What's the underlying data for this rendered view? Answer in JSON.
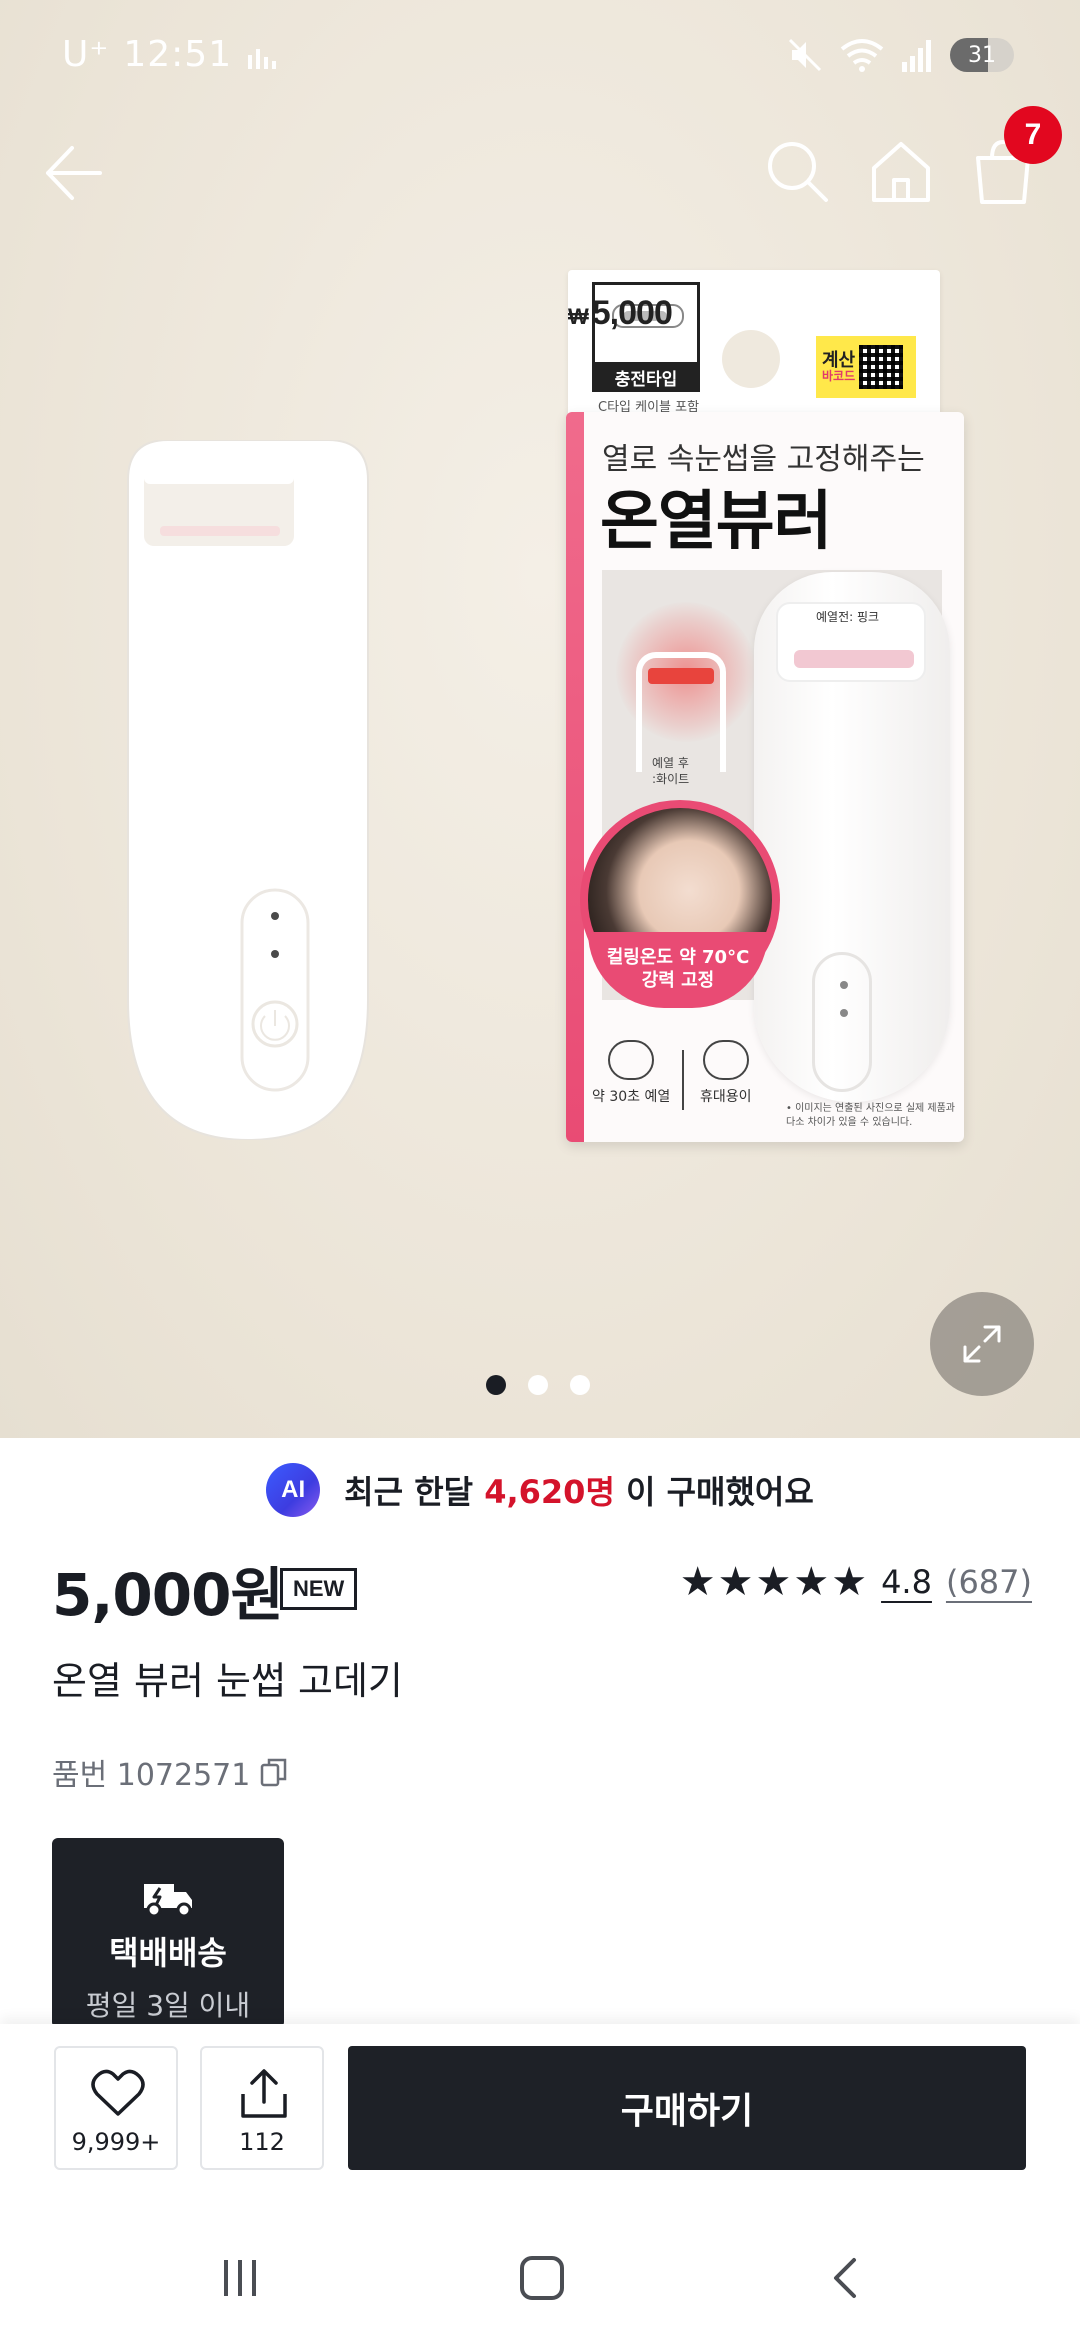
{
  "status_bar": {
    "carrier": "U⁺",
    "time": "12:51",
    "battery": "31"
  },
  "nav": {
    "cart_count": "7"
  },
  "product_box": {
    "charge_type": "충전타입",
    "charge_sub": "C타입 케이블 포함",
    "price": "5,000",
    "currency": "₩",
    "calc_label": "계산",
    "calc_sub": "바코드",
    "subtitle": "열로 속눈썹을 고정해주는",
    "name": "온열뷰러",
    "label_before": "예열전: 핑크",
    "label_after_1": "예열 후",
    "label_after_2": ":화이트",
    "ribbon_1": "컬링온도 약 70°C",
    "ribbon_2": "강력 고정",
    "feature_1": "약 30초 예열",
    "feature_2": "휴대용이",
    "note": "• 이미지는 연출된 사진으로 실제 제품과 다소 차이가 있을 수 있습니다."
  },
  "ai_banner": {
    "badge": "AI",
    "text_before": "최근 한달",
    "highlight": "4,620명",
    "text_after": "이 구매했어요"
  },
  "product": {
    "price": "5,000원",
    "badge": "NEW",
    "rating_score": "4.8",
    "rating_count": "(687)",
    "rating_value": 4.8,
    "name": "온열 뷰러 눈썹 고데기",
    "sku": "품번 1072571"
  },
  "delivery": {
    "title": "택배배송",
    "sub": "평일 3일 이내"
  },
  "bottom_bar": {
    "like_count": "9,999+",
    "share_count": "112",
    "buy_label": "구매하기"
  },
  "gallery": {
    "total": 3,
    "active": 1
  }
}
